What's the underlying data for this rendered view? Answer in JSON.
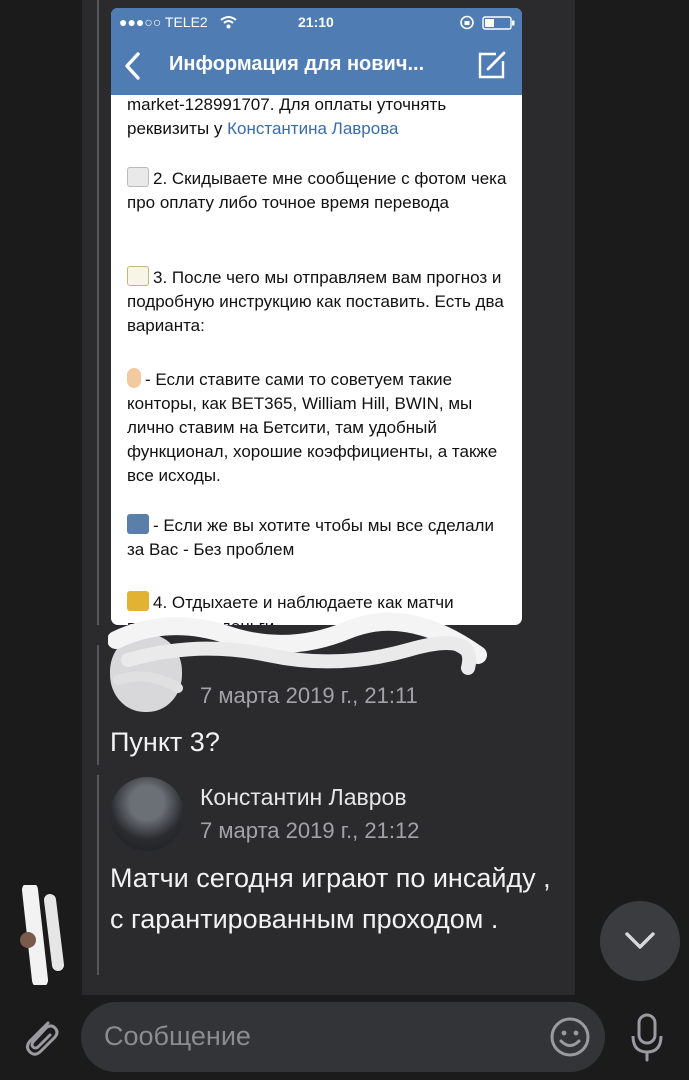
{
  "embedded_screenshot": {
    "status_bar": {
      "carrier": "●●●○○ TELE2",
      "time": "21:10"
    },
    "nav": {
      "title": "Информация для нович..."
    },
    "paragraphs": [
      {
        "text_before": "market-128991707. Для оплаты уточнять реквизиты у ",
        "link": "Константина Лаврова"
      },
      {
        "emoji": "page-emoji",
        "text": "2. Скидываете мне сообщение с фотом чека про оплату либо точное время перевода"
      },
      {
        "emoji": "memo-emoji",
        "text": "3. После чего мы отправляем вам прогноз и подробную инструкцию как поставить. Есть два варианта:"
      },
      {
        "emoji": "point-up-emoji",
        "text": "- Если ставите сами то советуем такие конторы, как BET365, William Hill, BWIN, мы лично ставим на Бетсити, там удобный функционал, хорошие коэффициенты, а также все исходы."
      },
      {
        "emoji": "businessman-emoji",
        "text": "- Если же вы хотите чтобы мы все сделали за Вас - Без проблем"
      },
      {
        "emoji": "megaphone-emoji",
        "text": "4. Отдыхаете и наблюдаете как матчи проходят, а деньги"
      }
    ]
  },
  "messages": [
    {
      "sender": "",
      "date": "7 марта 2019 г., 21:11",
      "text": "Пункт 3?"
    },
    {
      "sender": "Константин Лавров",
      "date": "7 марта 2019 г., 21:12",
      "text": "Матчи сегодня играют по инсайду , с гарантированным проходом ."
    }
  ],
  "composer": {
    "placeholder": "Сообщение"
  },
  "colors": {
    "chat_background": "#1b1b1c",
    "bubble_column": "#2b2b2d",
    "vk_blue": "#4f7db3",
    "link_blue": "#3a6ca8"
  },
  "icons": [
    "chevron-left-icon",
    "compose-icon",
    "wifi-icon",
    "lock-rotation-icon",
    "battery-icon",
    "chevron-down-icon",
    "paperclip-icon",
    "emoji-icon",
    "microphone-icon"
  ]
}
